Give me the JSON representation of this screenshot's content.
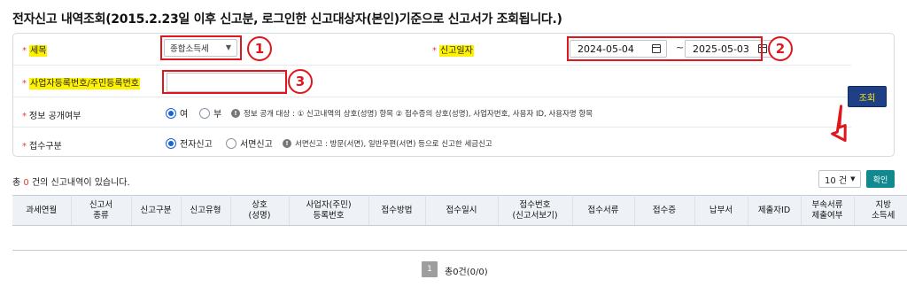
{
  "page": {
    "heading": "전자신고 내역조회(2015.2.23일 이후 신고분, 로그인한  신고대상자(본인)기준으로  신고서가 조회됩니다.)"
  },
  "search": {
    "tax_type_label": "세목",
    "tax_type_value": "종합소득세",
    "filing_date_label": "신고일자",
    "date_from": "2024-05-04",
    "date_to": "2025-05-03",
    "date_separator": "~",
    "biz_number_label": "사업자등록번호/주민등록번호",
    "biz_number_value": "",
    "disclosure_label": "정보 공개여부",
    "disclosure_yes": "여",
    "disclosure_no": "부",
    "disclosure_note": "정보 공개 대상 : ① 신고내역의 상호(성명) 항목 ② 접수증의 상호(성명), 사업자번호, 사용자 ID, 사용자명 항목",
    "receipt_type_label": "접수구분",
    "receipt_electronic": "전자신고",
    "receipt_paper": "서면신고",
    "receipt_note": "서면신고 : 방문(서면), 일반우편(서면) 등으로 신고한 세금신고",
    "search_button": "조회"
  },
  "annotations": {
    "marker1": "1",
    "marker2": "2",
    "marker3": "3"
  },
  "results": {
    "count_prefix": "총",
    "count": "0",
    "count_suffix": "건의 신고내역이 있습니다.",
    "per_page": "10 건",
    "confirm_button": "확인",
    "columns": [
      "과세연월",
      "신고서\n종류",
      "신고구분",
      "신고유형",
      "상호\n(성명)",
      "사업자(주민)\n등록번호",
      "접수방법",
      "접수일시",
      "접수번호\n(신고서보기)",
      "접수서류",
      "접수증",
      "납부서",
      "제출자ID",
      "부속서류\n제출여부",
      "지방\n소득세"
    ]
  },
  "pagination": {
    "current_page": "1",
    "summary": "총0건(0/0)"
  },
  "colors": {
    "accent_red": "#e1161c",
    "highlight": "#fff200",
    "search_button_bg": "#1f3f86",
    "confirm_button_bg": "#118a8f"
  }
}
